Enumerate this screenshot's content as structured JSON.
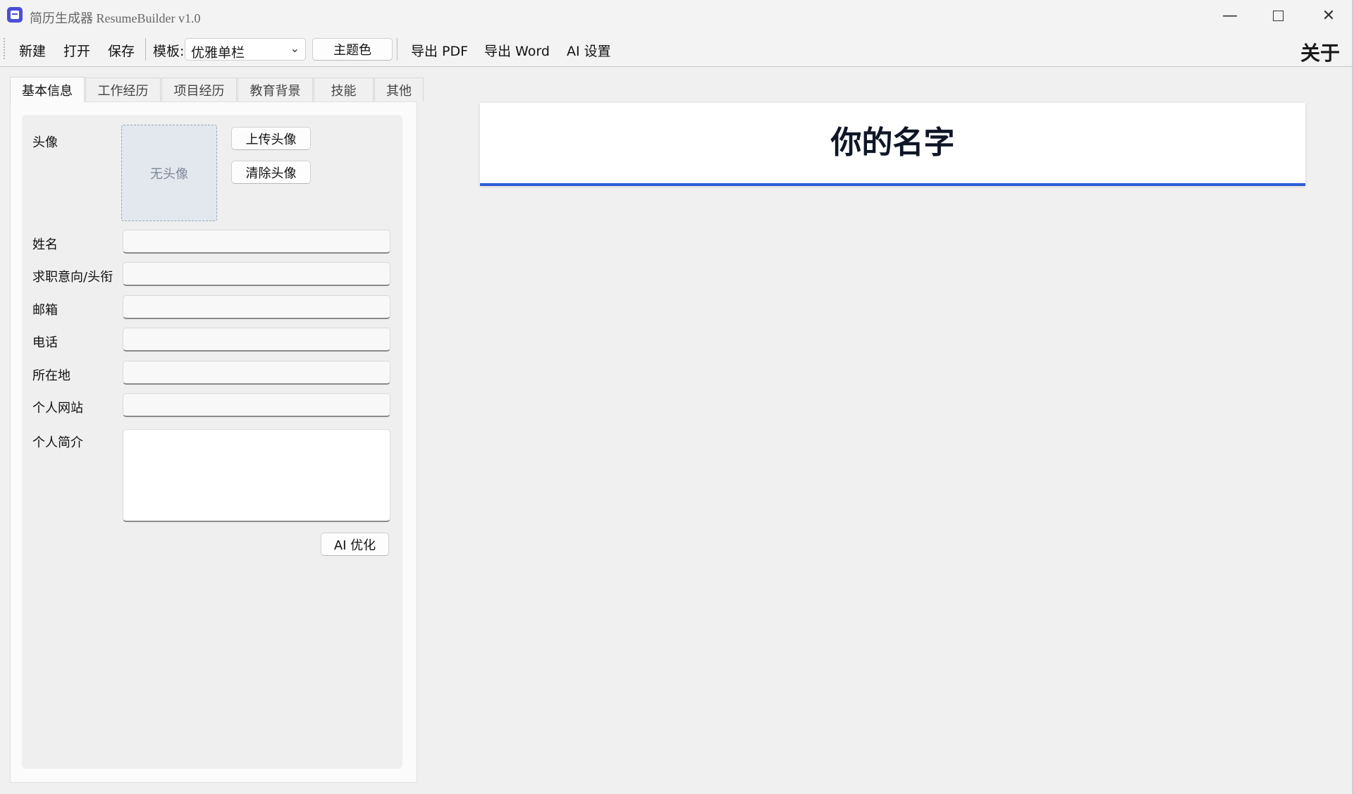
{
  "window": {
    "title": "简历生成器 ResumeBuilder  v1.0",
    "minimize_icon": "minimize-icon",
    "maximize_icon": "maximize-icon",
    "close_icon": "close-icon"
  },
  "menubar": {
    "new": "新建",
    "open": "打开",
    "save": "保存",
    "template_label": "模板:",
    "template_value": "优雅单栏",
    "theme_color": "主题色",
    "export_pdf": "导出 PDF",
    "export_word": "导出 Word",
    "ai_settings": "AI 设置",
    "about": "关于"
  },
  "tabs": [
    {
      "label": "基本信息",
      "active": true
    },
    {
      "label": "工作经历",
      "active": false
    },
    {
      "label": "项目经历",
      "active": false
    },
    {
      "label": "教育背景",
      "active": false
    },
    {
      "label": "技能",
      "active": false
    },
    {
      "label": "其他",
      "active": false
    }
  ],
  "form": {
    "avatar_label": "头像",
    "avatar_placeholder": "无头像",
    "upload_avatar": "上传头像",
    "clear_avatar": "清除头像",
    "name_label": "姓名",
    "title_label": "求职意向/头衔",
    "email_label": "邮箱",
    "phone_label": "电话",
    "location_label": "所在地",
    "website_label": "个人网站",
    "summary_label": "个人简介",
    "ai_optimize": "AI 优化",
    "name_value": "",
    "title_value": "",
    "email_value": "",
    "phone_value": "",
    "location_value": "",
    "website_value": "",
    "summary_value": ""
  },
  "preview": {
    "name": "你的名字",
    "accent_color": "#2b5fd6"
  }
}
